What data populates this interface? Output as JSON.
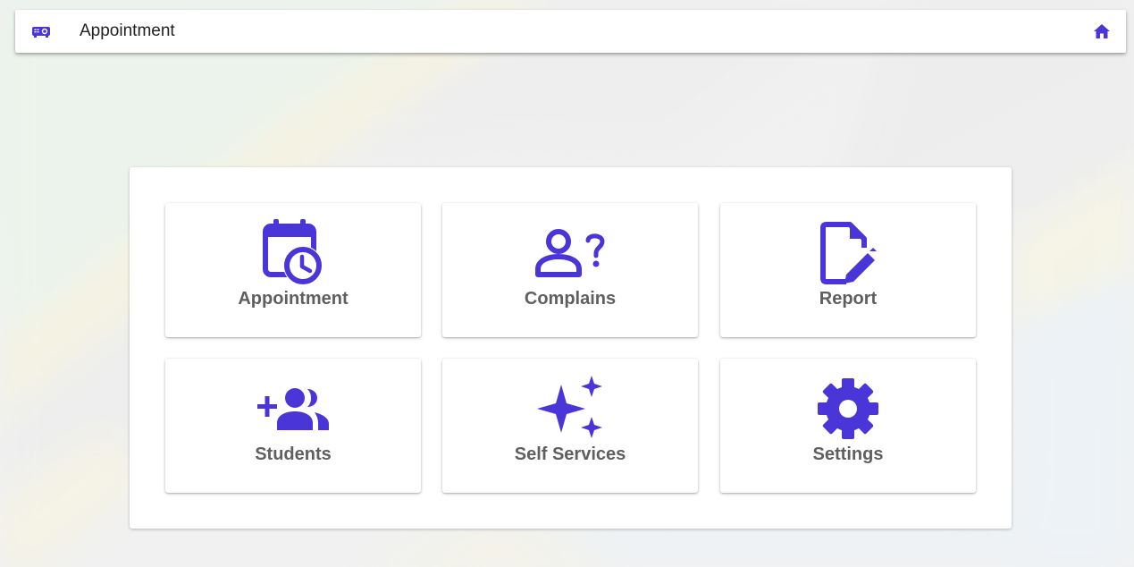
{
  "header": {
    "title": "Appointment",
    "logo_icon": "projector-icon",
    "home_icon": "home-icon"
  },
  "tiles": [
    {
      "label": "Appointment",
      "icon": "calendar-clock-icon"
    },
    {
      "label": "Complains",
      "icon": "person-question-icon"
    },
    {
      "label": "Report",
      "icon": "document-edit-icon"
    },
    {
      "label": "Students",
      "icon": "group-add-icon"
    },
    {
      "label": "Self Services",
      "icon": "sparkle-icon"
    },
    {
      "label": "Settings",
      "icon": "gear-icon"
    }
  ],
  "colors": {
    "accent": "#4a35d8",
    "label": "#5f5f5f",
    "flag_green": "#1eb53a",
    "flag_yellow": "#fcd116",
    "flag_blue": "#00a3dd"
  }
}
